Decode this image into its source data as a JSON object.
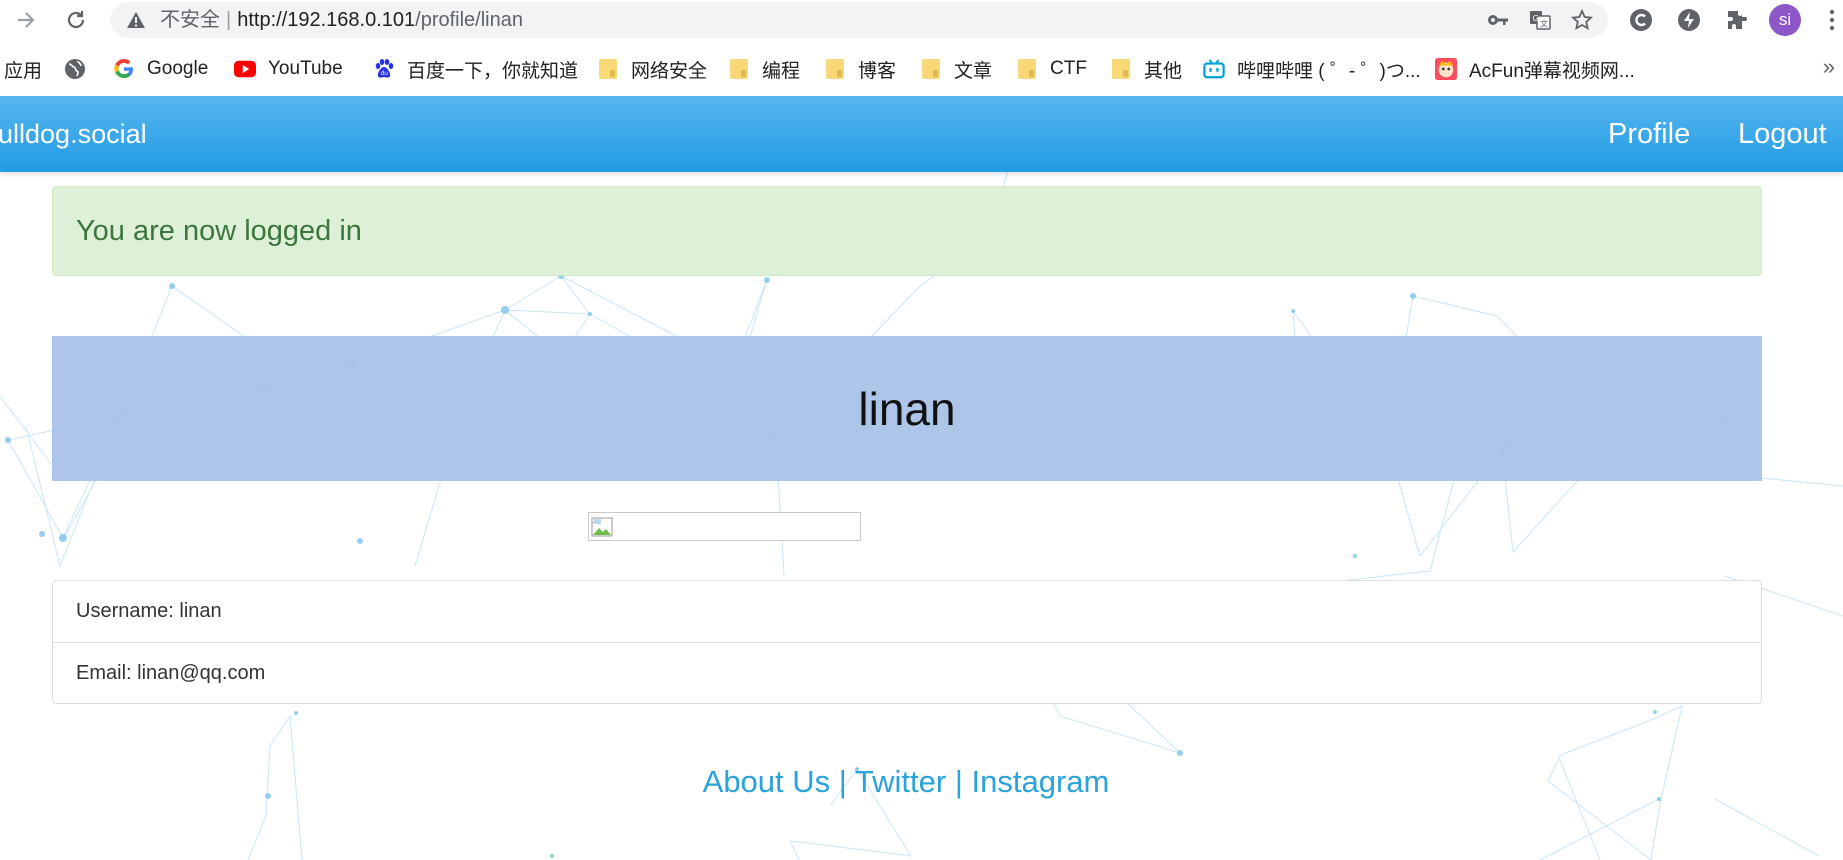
{
  "browser": {
    "security_label": "不安全",
    "url_host": "http://192.168.0.101",
    "url_path": "/profile/linan",
    "profile_initials": "si",
    "bookmarks": [
      {
        "label": "应用",
        "icon": "apps-grid-icon"
      },
      {
        "label": "",
        "icon": "globe-icon"
      },
      {
        "label": "Google",
        "icon": "google-icon"
      },
      {
        "label": "YouTube",
        "icon": "youtube-icon"
      },
      {
        "label": "百度一下，你就知道",
        "icon": "baidu-icon"
      },
      {
        "label": "网络安全",
        "icon": "folder-icon"
      },
      {
        "label": "编程",
        "icon": "folder-icon"
      },
      {
        "label": "博客",
        "icon": "folder-icon"
      },
      {
        "label": "文章",
        "icon": "folder-icon"
      },
      {
        "label": "CTF",
        "icon": "folder-icon"
      },
      {
        "label": "其他",
        "icon": "folder-icon"
      },
      {
        "label": "哔哩哔哩 ( ゜- ゜)つ...",
        "icon": "bilibili-icon"
      },
      {
        "label": "AcFun弹幕视频网...",
        "icon": "acfun-icon"
      }
    ]
  },
  "site": {
    "brand": "bulldog.social",
    "nav": {
      "profile": "Profile",
      "logout": "Logout"
    },
    "alert": "You are now logged in",
    "profile_name": "linan",
    "info": {
      "username": "Username: linan",
      "email": "Email: linan@qq.com"
    },
    "footer": {
      "about": "About Us",
      "sep": "|",
      "twitter": "Twitter",
      "instagram": "Instagram"
    }
  },
  "colors": {
    "nav_gradient_top": "#57b6ef",
    "nav_gradient_bottom": "#219be4",
    "alert_bg": "#dff0d8",
    "alert_text": "#3c763d",
    "hero_bg": "#a8c1e8",
    "link": "#2aa3dc",
    "avatar_bg": "#8e57c8"
  }
}
